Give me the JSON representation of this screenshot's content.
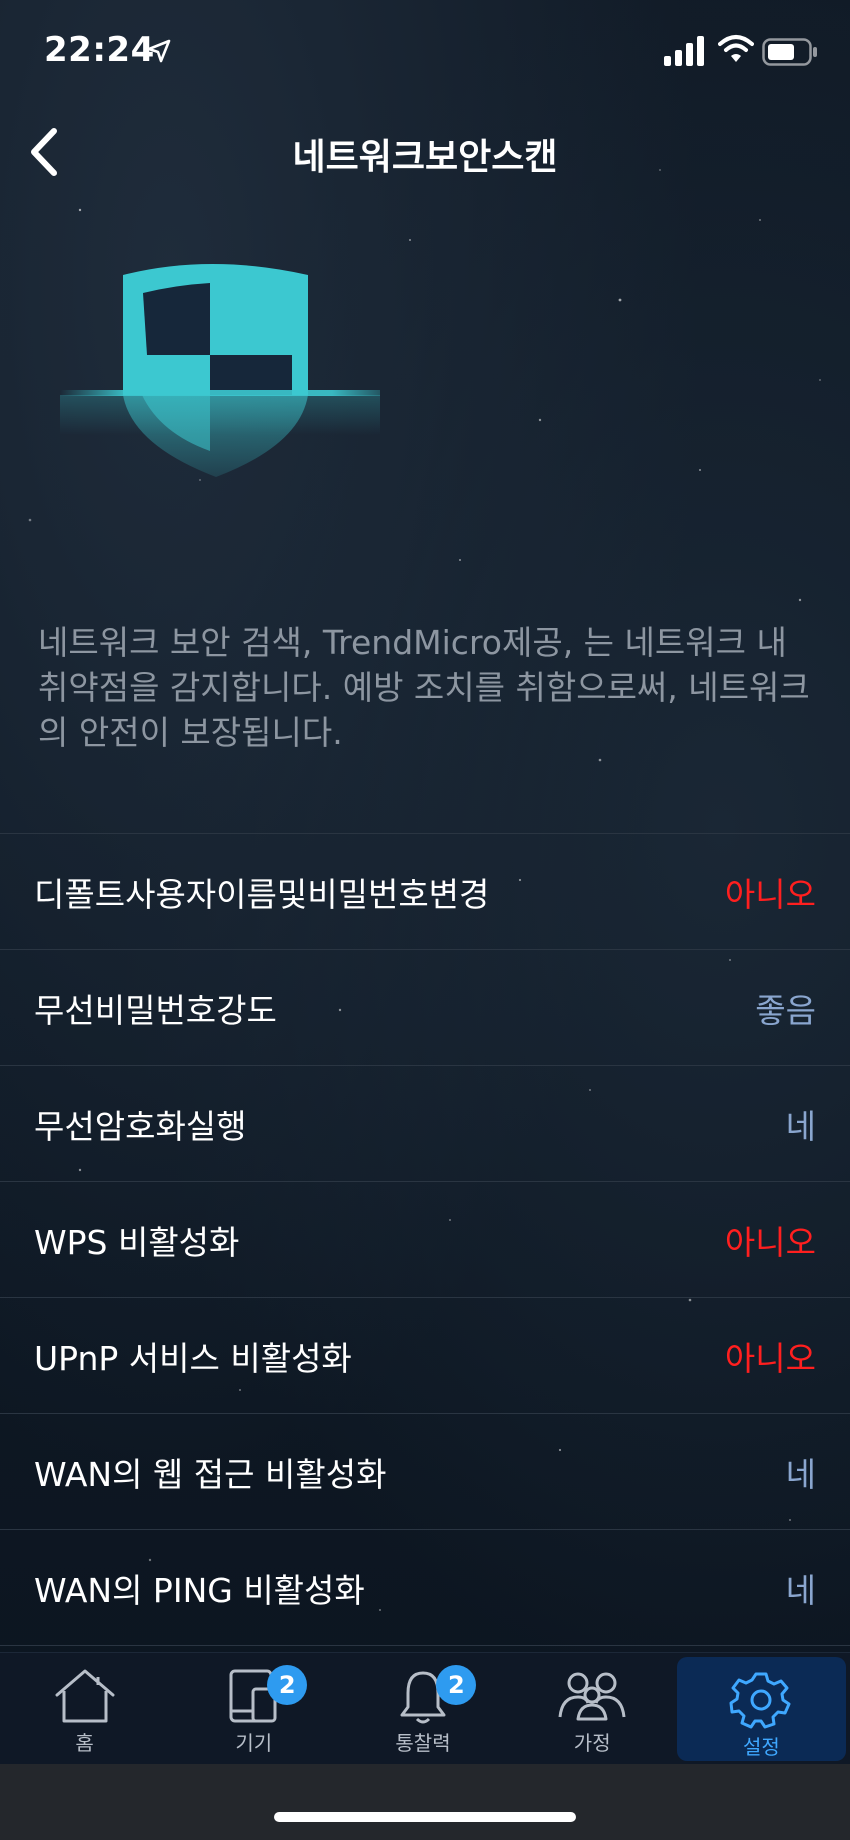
{
  "status_bar": {
    "time": "22:24"
  },
  "header": {
    "title": "네트워크보안스캔"
  },
  "description": "네트워크 보안 검색, TrendMicro제공, 는 네트워크 내 취약점을 감지합니다. 예방 조치를 취함으로써, 네트워크의 안전이 보장됩니다.",
  "items": [
    {
      "label": "디폴트사용자이름및비밀번호변경",
      "value": "아니오"
    },
    {
      "label": "무선비밀번호강도",
      "value": "좋음"
    },
    {
      "label": "무선암호화실행",
      "value": "네"
    },
    {
      "label": "WPS 비활성화",
      "value": "아니오"
    },
    {
      "label": "UPnP 서비스 비활성화",
      "value": "아니오"
    },
    {
      "label": "WAN의 웹 접근 비활성화",
      "value": "네"
    },
    {
      "label": "WAN의 PING 비활성화",
      "value": "네"
    }
  ],
  "tabs": [
    {
      "label": "홈",
      "icon": "home-icon",
      "badge": ""
    },
    {
      "label": "기기",
      "icon": "devices-icon",
      "badge": "2"
    },
    {
      "label": "통찰력",
      "icon": "bell-icon",
      "badge": "2"
    },
    {
      "label": "가정",
      "icon": "family-icon",
      "badge": ""
    },
    {
      "label": "설정",
      "icon": "gear-icon",
      "badge": ""
    }
  ],
  "colors": {
    "negative": "#ff1f1f",
    "positive": "#8aa6cf",
    "accent": "#3fa8ff",
    "shield": "#3cc8d0"
  }
}
